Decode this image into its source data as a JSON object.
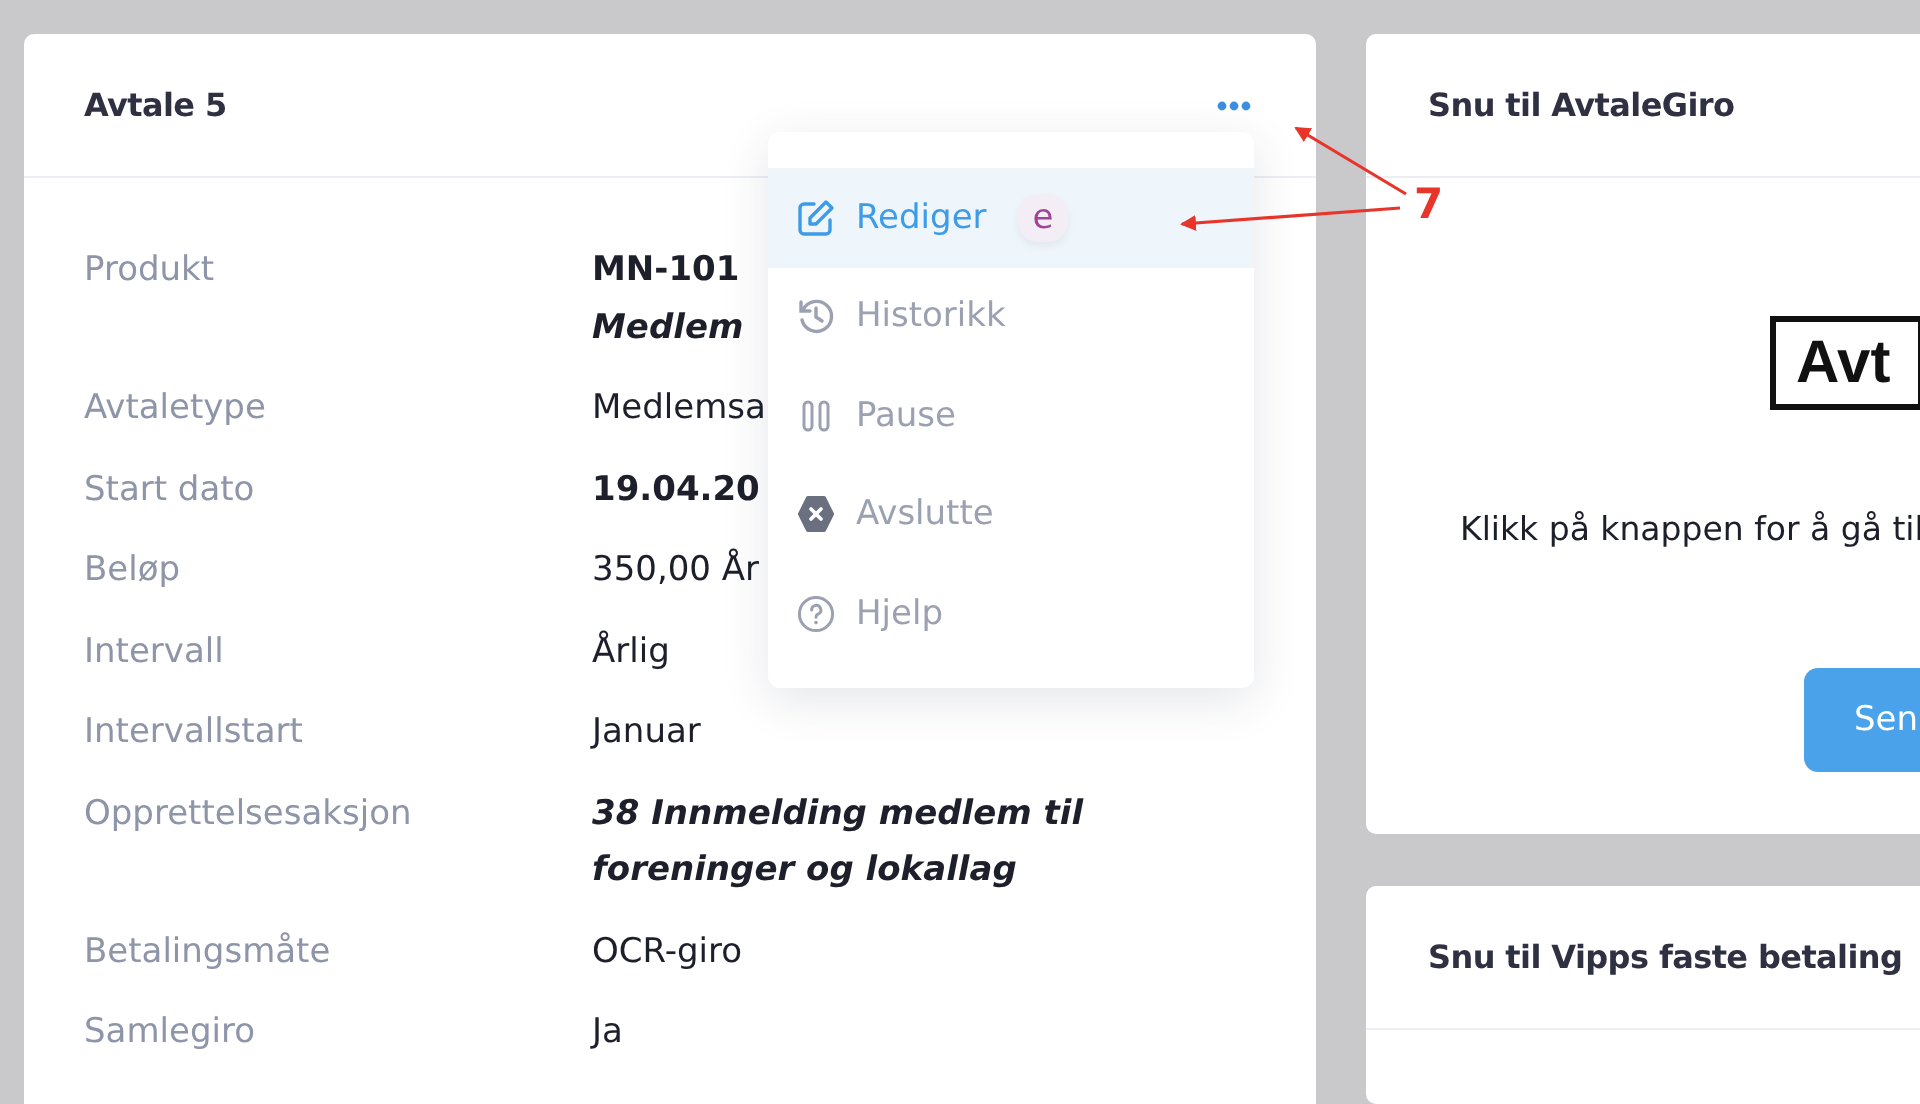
{
  "agreement_card": {
    "title": "Avtale 5",
    "fields": [
      {
        "label": "Produkt",
        "value": "MN-101",
        "value_line_2": "Medlem",
        "kind": "product"
      },
      {
        "label": "Avtaletype",
        "value": "Medlemsa",
        "kind": "text"
      },
      {
        "label": "Start dato",
        "value": "19.04.20",
        "kind": "date"
      },
      {
        "label": "Beløp",
        "value": "350,00 År",
        "kind": "text"
      },
      {
        "label": "Intervall",
        "value": "Årlig",
        "kind": "text"
      },
      {
        "label": "Intervallstart",
        "value": "Januar",
        "kind": "text"
      },
      {
        "label": "Opprettelsesaksjon",
        "value": "**38** Innmelding medlem til foreninger og lokallag",
        "kind": "action"
      },
      {
        "label": "Betalingsmåte",
        "value": "OCR-giro",
        "kind": "text"
      },
      {
        "label": "Samlegiro",
        "value": "Ja",
        "kind": "text"
      }
    ]
  },
  "menu": {
    "items": [
      {
        "label": "Rediger",
        "kind": "edit",
        "selected": true,
        "shortcut": "e"
      },
      {
        "label": "Historikk",
        "kind": "history",
        "selected": false
      },
      {
        "label": "Pause",
        "kind": "pause",
        "selected": false
      },
      {
        "label": "Avslutte",
        "kind": "end",
        "selected": false
      },
      {
        "label": "Hjelp",
        "kind": "help",
        "selected": false
      }
    ]
  },
  "avtalegiro_card": {
    "title": "Snu til AvtaleGiro",
    "logo_text": "Avt",
    "description": "Klikk på knappen for å gå til",
    "button": "Sen"
  },
  "vipps_card": {
    "title": "Snu til Vipps faste betaling"
  },
  "annotation": {
    "label": "7"
  }
}
